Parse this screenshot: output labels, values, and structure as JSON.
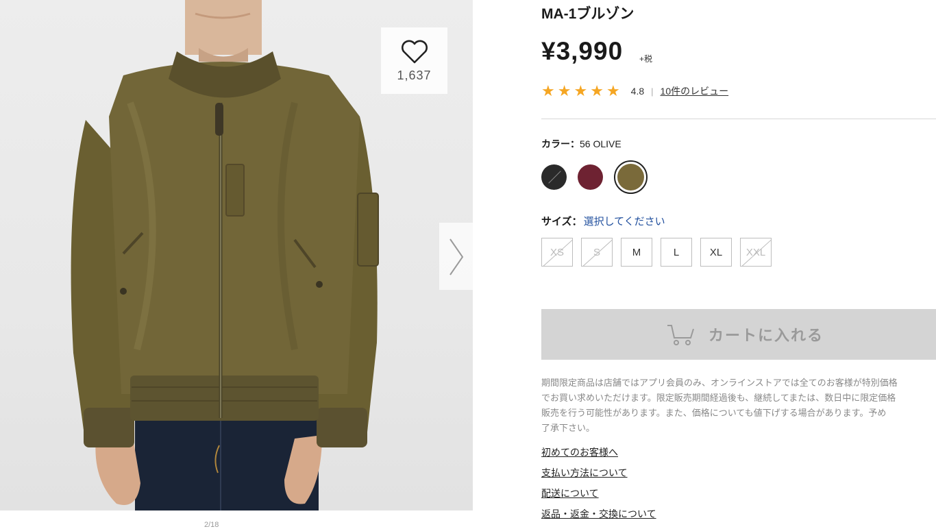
{
  "product": {
    "title": "MA-1ブルゾン",
    "price": "¥3,990",
    "tax_note": "+税",
    "favorites_count": "1,637",
    "image_counter": "2/18"
  },
  "rating": {
    "stars": 5,
    "score": "4.8",
    "separator": "|",
    "review_link": "10件のレビュー"
  },
  "color": {
    "label": "カラー：",
    "selected_value": "56 OLIVE",
    "swatches": [
      {
        "name": "black",
        "hex": "#2a2a2a",
        "available": false
      },
      {
        "name": "wine",
        "hex": "#6e2232",
        "available": true
      },
      {
        "name": "olive",
        "hex": "#7a6a3a",
        "available": true,
        "selected": true
      }
    ]
  },
  "size": {
    "label": "サイズ：",
    "prompt": "選択してください",
    "options": [
      {
        "label": "XS",
        "available": false
      },
      {
        "label": "S",
        "available": false
      },
      {
        "label": "M",
        "available": true
      },
      {
        "label": "L",
        "available": true
      },
      {
        "label": "XL",
        "available": true
      },
      {
        "label": "XXL",
        "available": false
      }
    ]
  },
  "cart": {
    "label": "カートに入れる",
    "icon": "cart-icon"
  },
  "notice": {
    "lines": [
      "期間限定商品は店舗ではアプリ会員のみ、オンラインストアでは全てのお客様が特別価格",
      "でお買い求めいただけます。限定販売期間経過後も、継続してまたは、数日中に限定価格",
      "販売を行う可能性があります。また、価格についても値下げする場合があります。予め",
      "了承下さい。"
    ]
  },
  "links": [
    "初めてのお客様へ",
    "支払い方法について",
    "配送について",
    "返品・返金・交換について"
  ],
  "colors": {
    "star": "#f5a623",
    "cart_bg": "#d4d4d4",
    "prompt_blue": "#1f4e9d",
    "jacket_olive": "#6f6434"
  }
}
